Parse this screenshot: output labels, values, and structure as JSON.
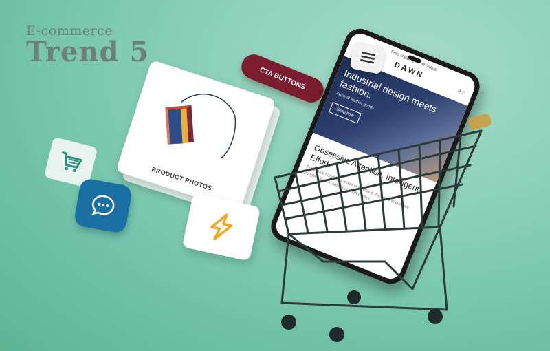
{
  "heading": {
    "eyebrow": "E-commerce",
    "title": "Trend 5"
  },
  "product_card": {
    "label": "PRODUCT PHOTOS"
  },
  "cta": {
    "label": "CTA BUTTONS"
  },
  "icons": {
    "cart": "shopping-cart-icon",
    "chat": "chat-bubble-icon",
    "bolt": "lightning-bolt-icon",
    "menu": "hamburger-menu-icon"
  },
  "phone": {
    "status_text": "Free shipping on all orders",
    "brand": "DAWN",
    "hero_title": "Industrial design meets fashion.",
    "hero_sub": "Atypical leather goods",
    "hero_button": "Shop now",
    "section_title": "Obsessive Attention. Intelligent Effort.",
    "section_body": "Functional handbags made of luxurious materials to improve people's lives in small but mighty ways"
  },
  "colors": {
    "background": "#88cfb7",
    "cta": "#7a1d2e",
    "chat_tile": "#1a6fa3",
    "bolt": "#f5a524"
  }
}
